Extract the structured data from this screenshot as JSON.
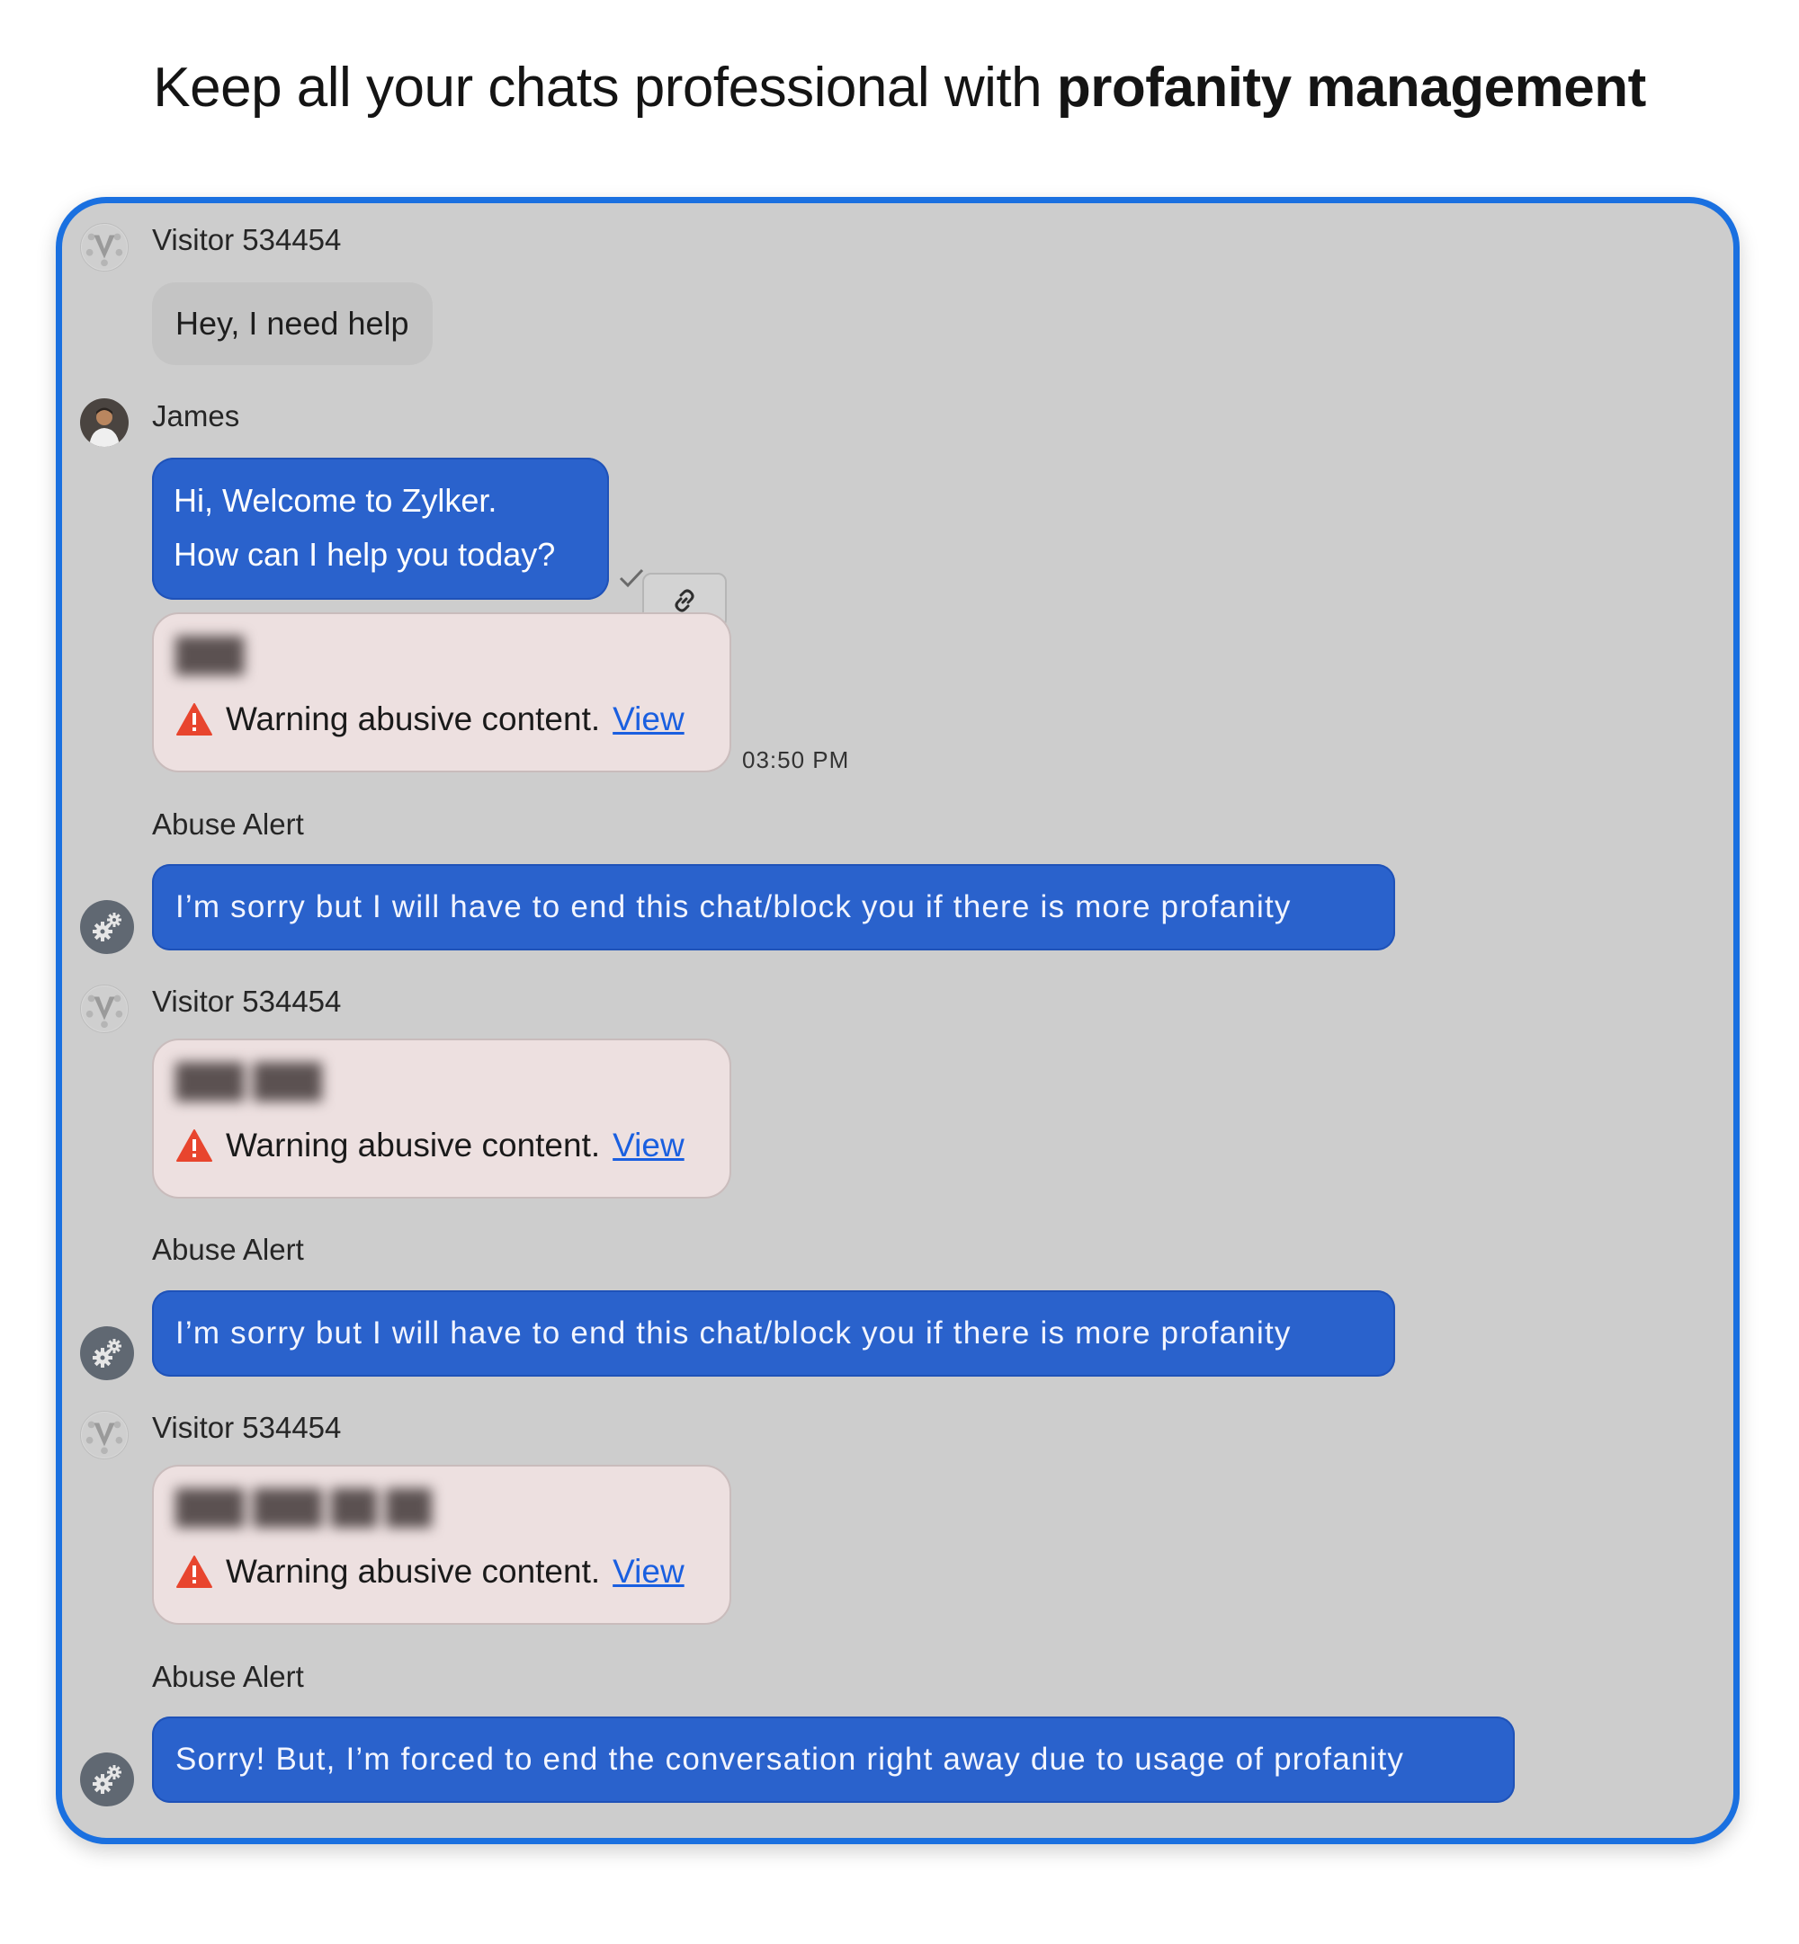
{
  "headline": {
    "regular": "Keep all your chats professional with",
    "bold": "profanity management"
  },
  "messages": [
    {
      "sender": "Visitor 534454",
      "text": "Hey, I need help"
    },
    {
      "sender": "James",
      "lines": [
        "Hi, Welcome to Zylker.",
        "How can I help you today?"
      ]
    },
    {
      "blurred": "███",
      "warning": "Warning abusive content.",
      "link": "View",
      "time": "03:50 PM"
    },
    {
      "sender": "Abuse Alert",
      "text": "I’m sorry but I will have to end this chat/block you if there is more profanity"
    },
    {
      "sender": "Visitor 534454",
      "blurred": "███ ███",
      "warning": "Warning abusive content.",
      "link": "View"
    },
    {
      "sender": "Abuse Alert",
      "text": "I’m sorry but I will have to end this chat/block you if there is more profanity"
    },
    {
      "sender": "Visitor 534454",
      "blurred": "███ ███ ██ ██",
      "warning": "Warning abusive content.",
      "link": "View"
    },
    {
      "sender": "Abuse Alert",
      "text": "Sorry! But, I’m forced to end the conversation right away due to usage of profanity"
    }
  ],
  "icons": {
    "visitor_avatar": "visitor-v-avatar",
    "agent_avatar": "agent-photo-avatar",
    "bot_avatar": "gear-bot-icon",
    "warning": "warning-triangle-icon",
    "link": "link-icon",
    "delivered": "check-icon"
  },
  "colors": {
    "frame_border": "#1a70e0",
    "chat_background": "#cdcdcd",
    "agent_bubble": "#2a62cc",
    "warning_card": "#ede0e0",
    "warning_icon": "#e8452e",
    "view_link": "#1a5fe0"
  }
}
